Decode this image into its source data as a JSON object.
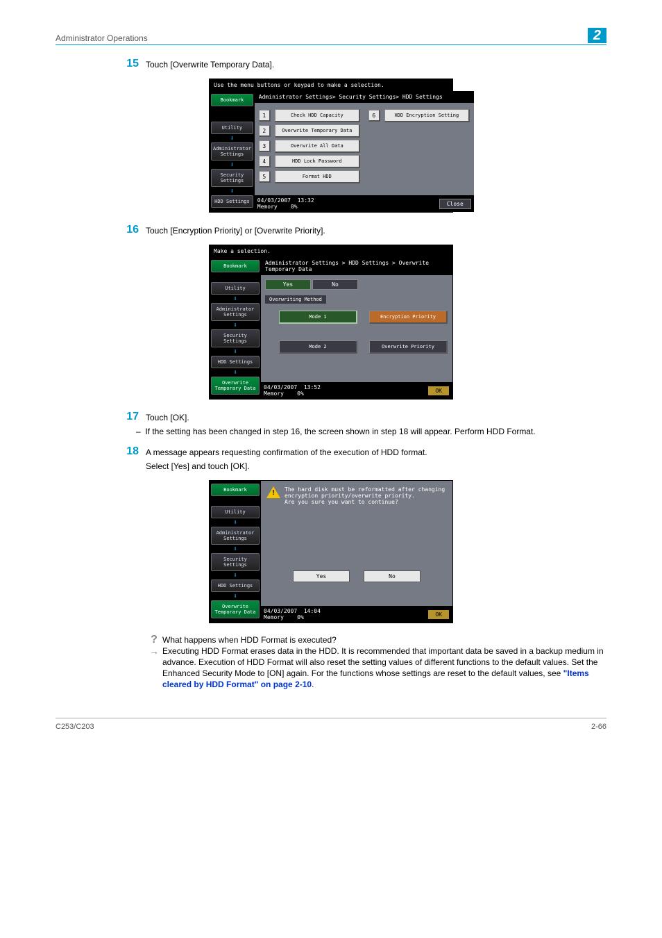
{
  "running_head": {
    "title": "Administrator Operations",
    "chapter": "2"
  },
  "steps": {
    "s15": {
      "num": "15",
      "text": "Touch [Overwrite Temporary Data]."
    },
    "s16": {
      "num": "16",
      "text": "Touch [Encryption Priority] or [Overwrite Priority]."
    },
    "s17": {
      "num": "17",
      "text": "Touch [OK].",
      "sub": "If the setting has been changed in step 16, the screen shown in step 18 will appear. Perform HDD Format."
    },
    "s18": {
      "num": "18",
      "text1": "A message appears requesting confirmation of the execution of HDD format.",
      "text2": "Select [Yes] and touch [OK]."
    }
  },
  "qa": {
    "q": "What happens when HDD Format is executed?",
    "a": "Executing HDD Format erases data in the HDD. It is recommended that important data be saved in a backup medium in advance. Execution of HDD Format will also reset the setting values of different functions to the default values. Set the Enhanced Security Mode to [ON] again. For the functions whose settings are reset to the default values, see ",
    "link": "\"Items cleared by HDD Format\" on page 2-10",
    "tail": "."
  },
  "screen1": {
    "top": "Use the menu buttons or keypad to make a selection.",
    "crumb": "Administrator Settings> Security Settings> HDD Settings",
    "nav": {
      "bookmark": "Bookmark",
      "utility": "Utility",
      "admin": "Administrator Settings",
      "security": "Security Settings",
      "hdd": "HDD Settings"
    },
    "opts": {
      "o1": "Check HDD Capacity",
      "o2": "Overwrite Temporary Data",
      "o3": "Overwrite All Data",
      "o4": "HDD Lock Password",
      "o5": "Format HDD",
      "o6": "HDD Encryption Setting"
    },
    "status": {
      "date": "04/03/2007",
      "time": "13:32",
      "mem": "Memory",
      "memv": "0%",
      "close": "Close"
    }
  },
  "screen2": {
    "top": "Make a selection.",
    "crumb": "Administrator Settings > HDD Settings > Overwrite Temporary Data",
    "yes": "Yes",
    "no": "No",
    "section": "Overwriting Method",
    "mode1": "Mode 1",
    "mode2": "Mode 2",
    "enc": "Encryption Priority",
    "over": "Overwrite Priority",
    "nav_extra": "Overwrite Temporary Data",
    "status": {
      "date": "04/03/2007",
      "time": "13:52",
      "mem": "Memory",
      "memv": "0%",
      "ok": "OK"
    }
  },
  "screen3": {
    "msg": "The hard disk must be reformatted after changing encryption priority/overwrite priority.\nAre you sure you want to continue?",
    "yes": "Yes",
    "no": "No",
    "status": {
      "date": "04/03/2007",
      "time": "14:04",
      "mem": "Memory",
      "memv": "0%",
      "ok": "OK"
    }
  },
  "footer": {
    "left": "C253/C203",
    "right": "2-66"
  }
}
